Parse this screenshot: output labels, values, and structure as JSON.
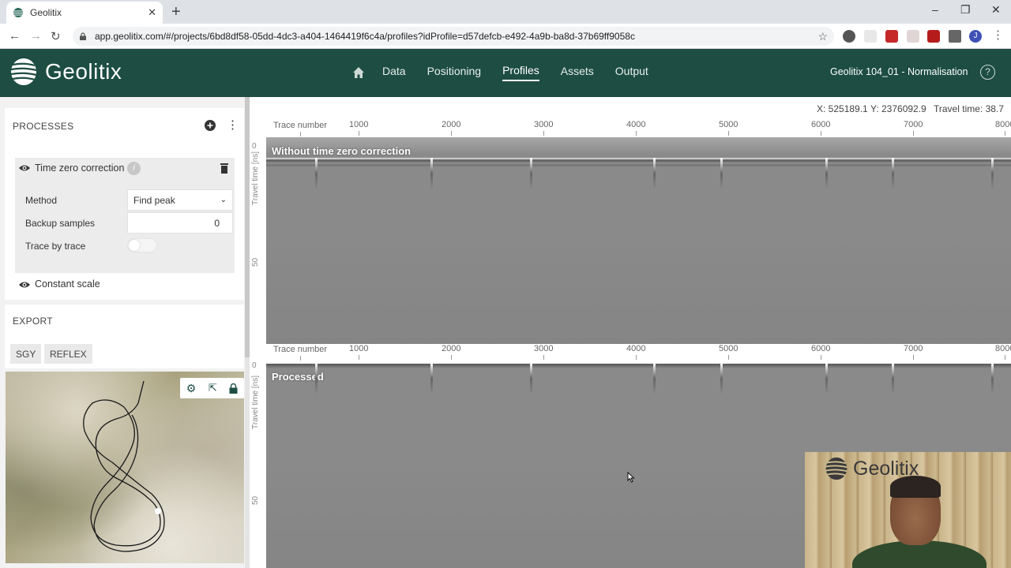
{
  "browser": {
    "tab_title": "Geolitix",
    "url": "app.geolitix.com/#/projects/6bd8df58-05dd-4dc3-a404-1464419f6c4a/profiles?idProfile=d57defcb-e492-4a9b-ba8d-37b69ff9058c",
    "profile_initial": "J"
  },
  "app": {
    "brand": "Geolitix",
    "nav": [
      {
        "label": "Data"
      },
      {
        "label": "Positioning"
      },
      {
        "label": "Profiles",
        "active": true
      },
      {
        "label": "Assets"
      },
      {
        "label": "Output"
      }
    ],
    "project_name": "Geolitix 104_01 - Normalisation",
    "help_label": "?"
  },
  "processes": {
    "title": "PROCESSES",
    "item": {
      "name": "Time zero correction",
      "method_label": "Method",
      "method_value": "Find peak",
      "backup_label": "Backup samples",
      "backup_value": "0",
      "trace_label": "Trace by trace",
      "trace_enabled": false
    },
    "second_item": "Constant scale"
  },
  "export": {
    "title": "EXPORT",
    "buttons": [
      "SGY",
      "REFLEX"
    ]
  },
  "coords": {
    "x": "X: 525189.1",
    "y": "Y: 2376092.9",
    "travel": "Travel time: 38.7"
  },
  "profiles": {
    "axis_title": "Trace number",
    "ticks": [
      "1000",
      "2000",
      "3000",
      "4000",
      "5000",
      "6000",
      "7000",
      "8000"
    ],
    "y_axis_label": "Travel time [ns]",
    "y_ticks": [
      "0",
      "50"
    ],
    "panels": [
      {
        "label": "Without time zero correction"
      },
      {
        "label": "Processed"
      }
    ]
  },
  "webcam": {
    "logo": "Geolitix"
  },
  "colors": {
    "header": "#1d4d43",
    "radar_gray": "#8a8a8a"
  }
}
